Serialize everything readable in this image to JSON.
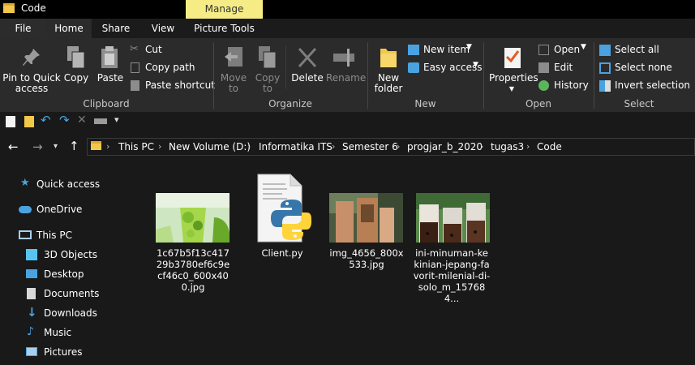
{
  "window": {
    "title": "Code",
    "manage_tab": "Manage"
  },
  "tabs": [
    {
      "label": "File"
    },
    {
      "label": "Home"
    },
    {
      "label": "Share"
    },
    {
      "label": "View"
    },
    {
      "label": "Picture Tools"
    }
  ],
  "ribbon": {
    "clipboard": {
      "pin_line1": "Pin to Quick",
      "pin_line2": "access",
      "copy": "Copy",
      "paste": "Paste",
      "cut": "Cut",
      "copy_path": "Copy path",
      "paste_shortcut": "Paste shortcut",
      "group": "Clipboard"
    },
    "organize": {
      "move_line1": "Move",
      "move_line2": "to",
      "copy_line1": "Copy",
      "copy_line2": "to",
      "delete": "Delete",
      "rename": "Rename",
      "group": "Organize"
    },
    "new": {
      "folder_line1": "New",
      "folder_line2": "folder",
      "new_item": "New item",
      "easy_access": "Easy access",
      "group": "New"
    },
    "open": {
      "properties": "Properties",
      "open": "Open",
      "edit": "Edit",
      "history": "History",
      "group": "Open"
    },
    "select": {
      "select_all": "Select all",
      "select_none": "Select none",
      "invert": "Invert selection",
      "group": "Select"
    }
  },
  "breadcrumbs": [
    "This PC",
    "New Volume (D:)",
    "Informatika ITS",
    "Semester 6",
    "progjar_b_2020",
    "tugas3",
    "Code"
  ],
  "nav": [
    {
      "label": "Quick access",
      "icon": "star-icon"
    },
    {
      "label": "OneDrive",
      "icon": "cloud-icon"
    },
    {
      "label": "This PC",
      "icon": "computer-icon"
    },
    {
      "label": "3D Objects",
      "icon": "cube-icon"
    },
    {
      "label": "Desktop",
      "icon": "desktop-icon"
    },
    {
      "label": "Documents",
      "icon": "document-icon"
    },
    {
      "label": "Downloads",
      "icon": "download-icon"
    },
    {
      "label": "Music",
      "icon": "music-icon"
    },
    {
      "label": "Pictures",
      "icon": "pictures-icon"
    }
  ],
  "files": [
    {
      "name": "1c67b5f13c41729b3780ef6c9ecf46c0_600x400.jpg"
    },
    {
      "name": "Client.py"
    },
    {
      "name": "img_4656_800x533.jpg"
    },
    {
      "name": "ini-minuman-kekinian-jepang-favorit-milenial-di-solo_m_157684..."
    }
  ],
  "colors": {
    "accent": "#f6ec86",
    "folder": "#f2c84b",
    "background": "#191919",
    "ribbon": "#2b2b2b"
  }
}
